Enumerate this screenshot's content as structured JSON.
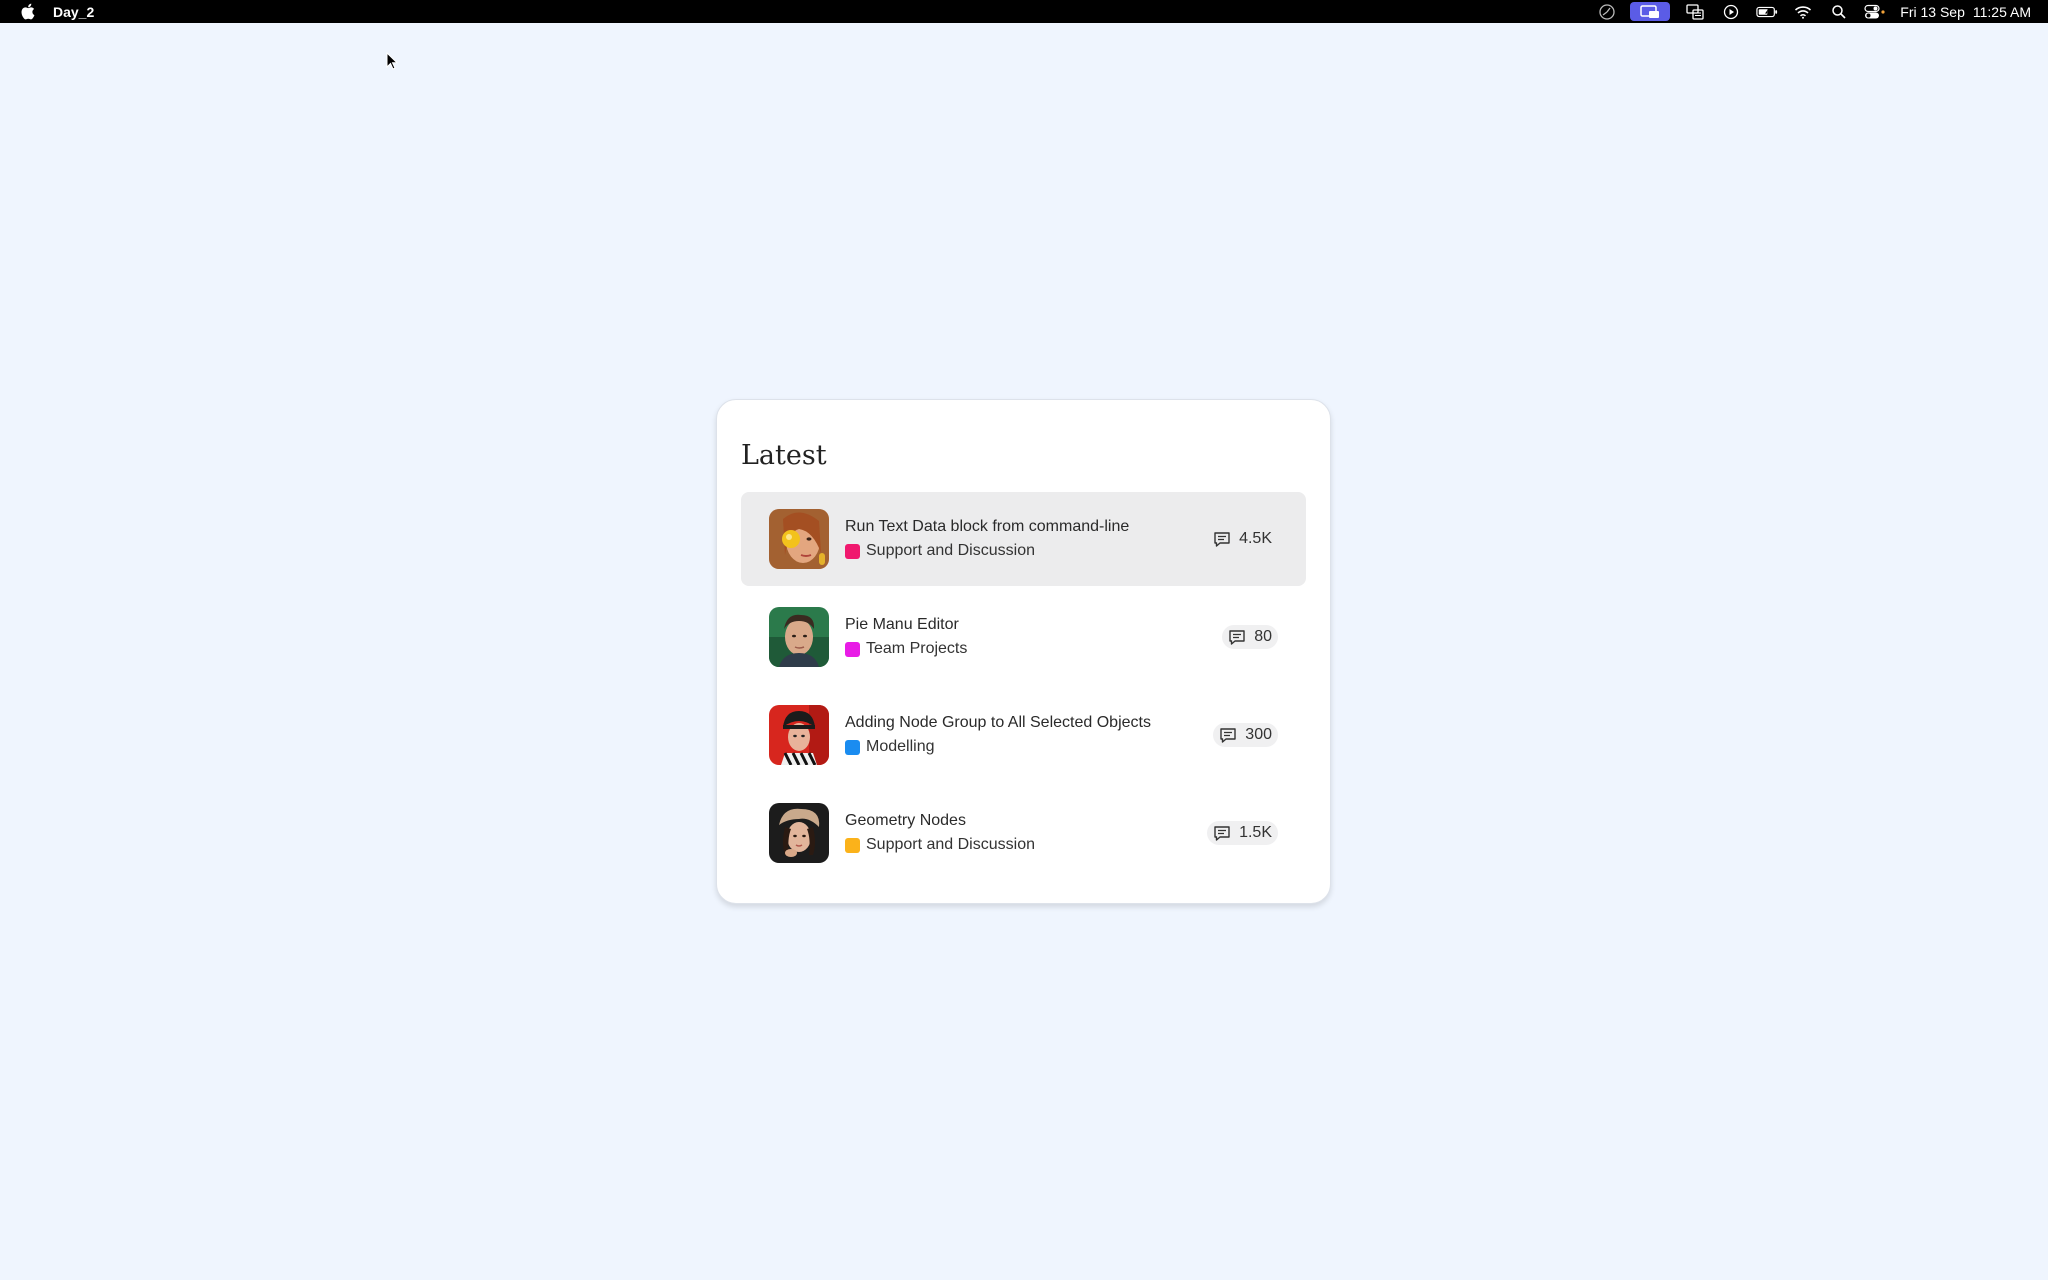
{
  "menubar": {
    "app_name": "Day_2",
    "date": "Fri 13 Sep",
    "time": "11:25 AM",
    "icons": [
      "apple-logo",
      "stopwatch-icon",
      "screen-mirroring-icon",
      "display-icon",
      "play-icon",
      "battery-icon",
      "wifi-icon",
      "search-icon",
      "control-center-icon"
    ]
  },
  "card": {
    "title": "Latest",
    "topics": [
      {
        "title": "Run Text Data block from command-line",
        "category": "Support and Discussion",
        "category_color": "#f0186e",
        "replies": "4.5K",
        "highlighted": true
      },
      {
        "title": "Pie Manu Editor",
        "category": "Team Projects",
        "category_color": "#e81ce6",
        "replies": "80",
        "highlighted": false
      },
      {
        "title": "Adding Node Group to All Selected Objects",
        "category": "Modelling",
        "category_color": "#1a8cf0",
        "replies": "300",
        "highlighted": false
      },
      {
        "title": "Geometry Nodes",
        "category": "Support and Discussion",
        "category_color": "#fbb21a",
        "replies": "1.5K",
        "highlighted": false
      }
    ]
  }
}
